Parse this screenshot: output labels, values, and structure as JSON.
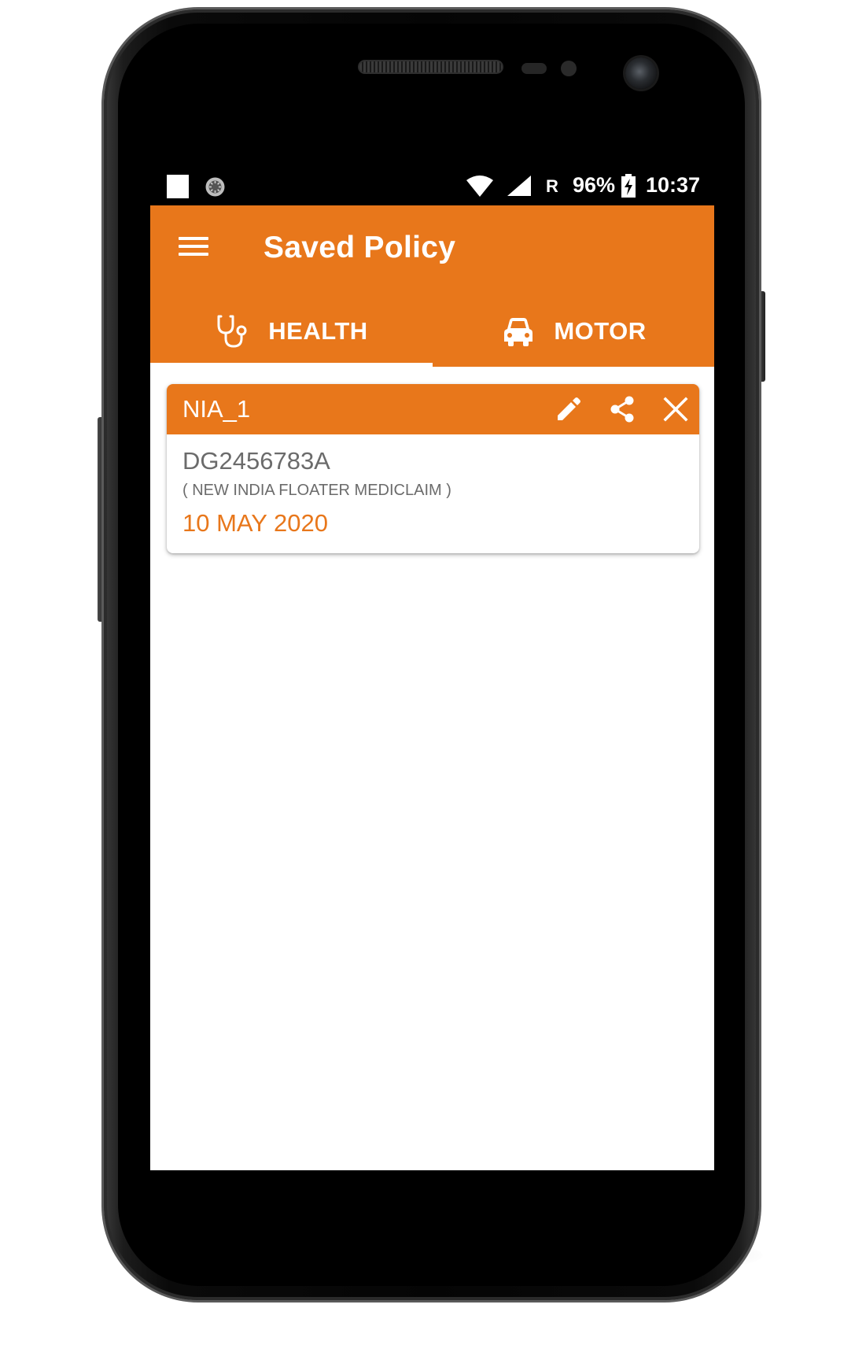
{
  "status_bar": {
    "network_type": "R",
    "battery_percent": "96%",
    "time": "10:37",
    "icons": [
      "notification-square-icon",
      "sync-icon",
      "wifi-icon",
      "signal-icon",
      "battery-charging-icon"
    ]
  },
  "app_bar": {
    "title": "Saved Policy",
    "menu_icon": "hamburger-menu-icon"
  },
  "tabs": [
    {
      "label": "HEALTH",
      "icon": "stethoscope-icon",
      "selected": true
    },
    {
      "label": "MOTOR",
      "icon": "car-icon",
      "selected": false
    }
  ],
  "policies": [
    {
      "title": "NIA_1",
      "policy_number": "DG2456783A",
      "policy_name": "( NEW INDIA FLOATER MEDICLAIM )",
      "date": "10 MAY 2020",
      "actions": [
        "edit-icon",
        "share-icon",
        "close-icon"
      ]
    }
  ],
  "colors": {
    "primary": "#e8771b",
    "text_secondary": "#6b6b6b",
    "on_primary": "#ffffff",
    "status_bar": "#000000"
  }
}
